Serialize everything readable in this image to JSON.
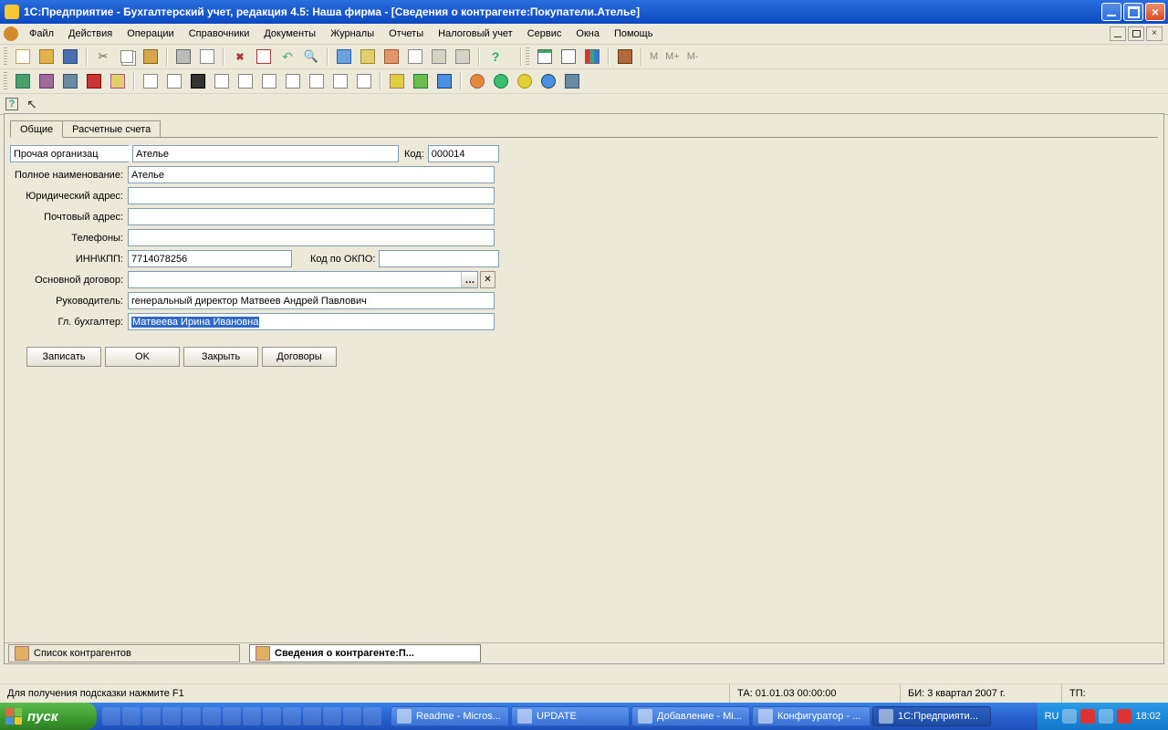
{
  "window": {
    "title": "1С:Предприятие - Бухгалтерский учет, редакция 4.5: Наша фирма - [Сведения о контрагенте:Покупатели.Ателье]"
  },
  "menu": {
    "items": [
      "Файл",
      "Действия",
      "Операции",
      "Справочники",
      "Документы",
      "Журналы",
      "Отчеты",
      "Налоговый учет",
      "Сервис",
      "Окна",
      "Помощь"
    ]
  },
  "text_buttons": {
    "m": "M",
    "mplus": "M+",
    "mminus": "M-"
  },
  "tabs": {
    "general": "Общие",
    "accounts": "Расчетные счета"
  },
  "form": {
    "org_type_value": "Прочая организац",
    "name_value": "Ателье",
    "code_label": "Код:",
    "code_value": "000014",
    "fullname_label": "Полное наименование:",
    "fullname_value": "Ателье",
    "legal_addr_label": "Юридический адрес:",
    "legal_addr_value": "",
    "post_addr_label": "Почтовый адрес:",
    "post_addr_value": "",
    "phones_label": "Телефоны:",
    "phones_value": "",
    "inn_label": "ИНН\\КПП:",
    "inn_value": "7714078256",
    "okpo_label": "Код по ОКПО:",
    "okpo_value": "",
    "main_contract_label": "Основной договор:",
    "main_contract_value": "",
    "head_label": "Руководитель:",
    "head_value": "генеральный директор Матвеев Андрей Павлович",
    "accountant_label": "Гл. бухгалтер:",
    "accountant_value": "Матвеева Ирина Ивановна"
  },
  "buttons": {
    "write": "Записать",
    "ok": "OK",
    "close": "Закрыть",
    "contracts": "Договоры"
  },
  "mdi_tabs": {
    "list": "Список контрагентов",
    "details": "Сведения о контрагенте:П..."
  },
  "status": {
    "hint": "Для получения подсказки нажмите F1",
    "ta": "ТА: 01.01.03  00:00:00",
    "bi": "БИ: 3 квартал 2007 г.",
    "tp": "ТП:"
  },
  "taskbar": {
    "start": "пуск",
    "tasks": [
      "Readme - Micros...",
      "UPDATE",
      "Добавление - Mi...",
      "Конфигуратор - ...",
      "1С:Предприяти..."
    ],
    "lang": "RU",
    "clock": "18:02"
  }
}
